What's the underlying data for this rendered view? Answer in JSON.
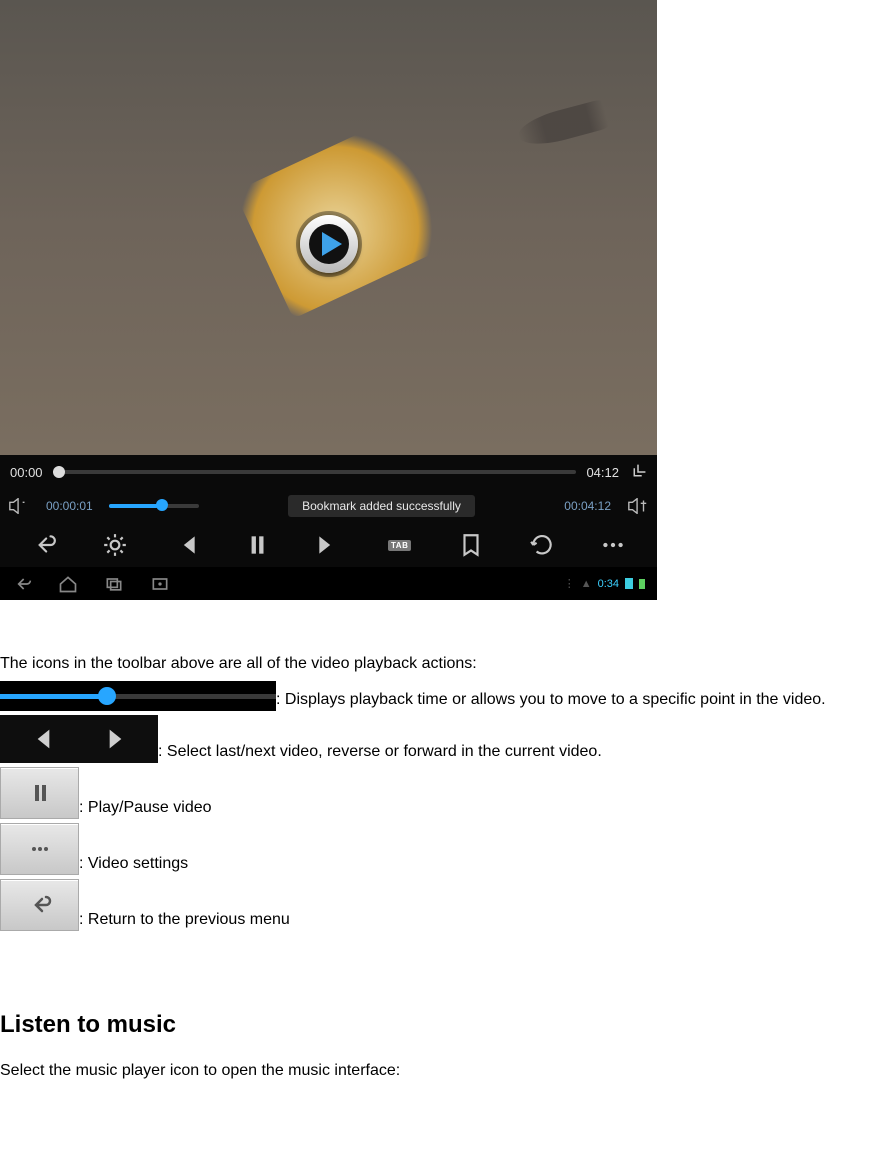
{
  "screenshot": {
    "timebar": {
      "start": "00:00",
      "end": "04:12"
    },
    "controlbar1": {
      "current_time": "00:00:01",
      "total_time": "00:04:12",
      "toast": "Bookmark added successfully"
    },
    "controlbar2": {
      "tab_label": "TAB"
    },
    "navbar": {
      "clock": "0:34"
    }
  },
  "text": {
    "intro": "The icons in the toolbar above are all of the video playback actions:",
    "slider_desc": ": Displays playback time or allows you to move to a specific point in the video.",
    "prevnext_desc": ": Select last/next video, reverse or forward in the current video.",
    "pause_desc": ": Play/Pause video",
    "settings_desc": ": Video settings",
    "return_desc": ": Return to the previous menu",
    "heading": "Listen to music",
    "music_intro": "Select the music player icon to open the music interface:"
  }
}
